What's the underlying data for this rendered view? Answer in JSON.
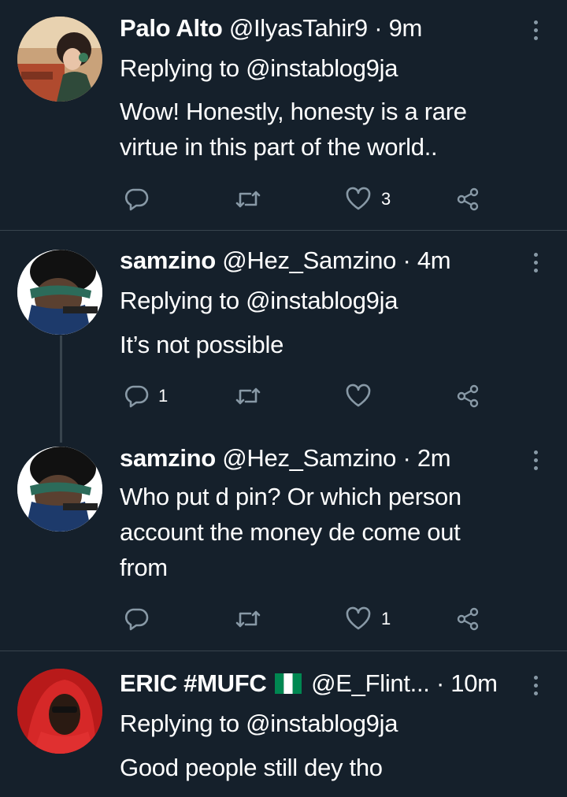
{
  "tweets": [
    {
      "name": "Palo Alto",
      "handle": "@IlyasTahir9",
      "time": "9m",
      "replying": "Replying to @instablog9ja",
      "text_lines": [
        "Wow! Honestly, honesty is a rare",
        "virtue in this part of the world.."
      ],
      "reply_count": "",
      "like_count": "3"
    },
    {
      "name": "samzino",
      "handle": "@Hez_Samzino",
      "time": "4m",
      "replying": "Replying to @instablog9ja",
      "text_lines": [
        "It’s not possible"
      ],
      "reply_count": "1",
      "like_count": ""
    },
    {
      "name": "samzino",
      "handle": "@Hez_Samzino",
      "time": "2m",
      "replying": "",
      "text_lines": [
        "Who put d pin?  Or which person",
        "account the money de come out",
        "from"
      ],
      "reply_count": "",
      "like_count": "1"
    },
    {
      "name": "ERIC #MUFC",
      "flag": "Nigeria flag",
      "handle": "@E_Flint...",
      "time": "10m",
      "replying": "Replying to @instablog9ja",
      "text_lines": [
        "Good people still dey tho"
      ],
      "reply_count": "",
      "like_count": ""
    }
  ],
  "separator": "·",
  "icons": {
    "reply": "reply-icon",
    "retweet": "retweet-icon",
    "like": "heart-icon",
    "share": "share-icon",
    "more": "more-vertical-icon"
  },
  "colors": {
    "background": "#15202b",
    "icon": "#8899a6",
    "divider": "#38444d"
  }
}
